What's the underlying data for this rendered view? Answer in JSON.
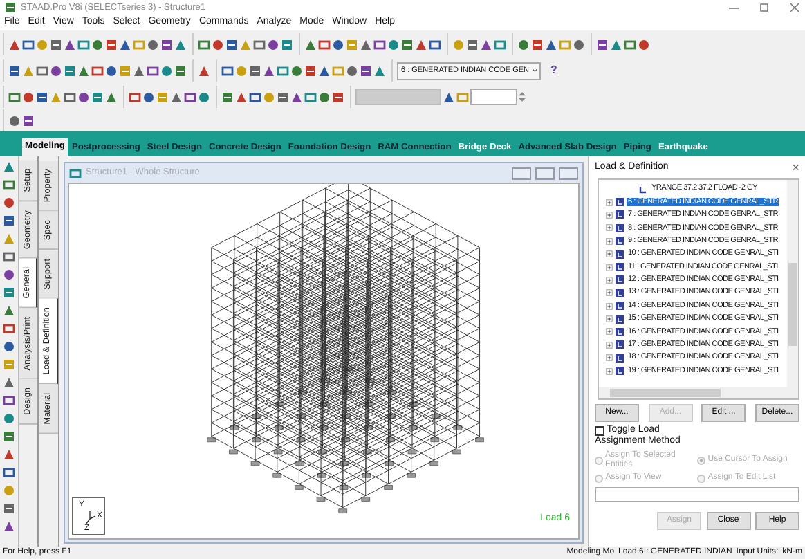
{
  "window": {
    "title": "STAAD.Pro V8i (SELECTseries 3) - Structure1"
  },
  "menu": [
    "File",
    "Edit",
    "View",
    "Tools",
    "Select",
    "Geometry",
    "Commands",
    "Analyze",
    "Mode",
    "Window",
    "Help"
  ],
  "toolbar": {
    "load_dropdown": "6 : GENERATED INDIAN CODE GEN",
    "help_glyph": "?"
  },
  "module_tabs": [
    {
      "label": "Modeling",
      "selected": true,
      "kind": "core"
    },
    {
      "label": "Postprocessing",
      "selected": false,
      "kind": "core"
    },
    {
      "label": "Steel Design",
      "selected": false,
      "kind": "core"
    },
    {
      "label": "Concrete Design",
      "selected": false,
      "kind": "core"
    },
    {
      "label": "Foundation Design",
      "selected": false,
      "kind": "core"
    },
    {
      "label": "RAM Connection",
      "selected": false,
      "kind": "core"
    },
    {
      "label": "Bridge Deck",
      "selected": false,
      "kind": "addon"
    },
    {
      "label": "Advanced Slab Design",
      "selected": false,
      "kind": "core"
    },
    {
      "label": "Piping",
      "selected": false,
      "kind": "core"
    },
    {
      "label": "Earthquake",
      "selected": false,
      "kind": "addon"
    }
  ],
  "page_tabs": [
    {
      "label": "Setup",
      "selected": false
    },
    {
      "label": "Geometry",
      "selected": false
    },
    {
      "label": "General",
      "selected": true
    },
    {
      "label": "Analysis/Print",
      "selected": false
    },
    {
      "label": "Design",
      "selected": false
    }
  ],
  "sub_tabs": [
    {
      "label": "Property",
      "selected": false
    },
    {
      "label": "Spec",
      "selected": false
    },
    {
      "label": "Support",
      "selected": false
    },
    {
      "label": "Load & Definition",
      "selected": true
    },
    {
      "label": "Material",
      "selected": false
    }
  ],
  "structure_window": {
    "title": "Structure1 - Whole Structure",
    "load_label": "Load 6",
    "axes": [
      "Y",
      "X",
      "Z"
    ]
  },
  "load_panel": {
    "title": "Load & Definition",
    "close": "×",
    "tree": [
      {
        "label": "YRANGE 37.2 37.2 FLOAD -2 GY",
        "kind": "load",
        "selected": false
      },
      {
        "label": "6 : GENERATED INDIAN CODE GENRAL_STR",
        "kind": "case",
        "selected": true
      },
      {
        "label": "7 : GENERATED INDIAN CODE GENRAL_STR",
        "kind": "case",
        "selected": false
      },
      {
        "label": "8 : GENERATED INDIAN CODE GENRAL_STR",
        "kind": "case",
        "selected": false
      },
      {
        "label": "9 : GENERATED INDIAN CODE GENRAL_STR",
        "kind": "case",
        "selected": false
      },
      {
        "label": "10 : GENERATED INDIAN CODE GENRAL_STI",
        "kind": "case",
        "selected": false
      },
      {
        "label": "11 : GENERATED INDIAN CODE GENRAL_STI",
        "kind": "case",
        "selected": false
      },
      {
        "label": "12 : GENERATED INDIAN CODE GENRAL_STI",
        "kind": "case",
        "selected": false
      },
      {
        "label": "13 : GENERATED INDIAN CODE GENRAL_STI",
        "kind": "case",
        "selected": false
      },
      {
        "label": "14 : GENERATED INDIAN CODE GENRAL_STI",
        "kind": "case",
        "selected": false
      },
      {
        "label": "15 : GENERATED INDIAN CODE GENRAL_STI",
        "kind": "case",
        "selected": false
      },
      {
        "label": "16 : GENERATED INDIAN CODE GENRAL_STI",
        "kind": "case",
        "selected": false
      },
      {
        "label": "17 : GENERATED INDIAN CODE GENRAL_STI",
        "kind": "case",
        "selected": false
      },
      {
        "label": "18 : GENERATED INDIAN CODE GENRAL_STI",
        "kind": "case",
        "selected": false
      },
      {
        "label": "19 : GENERATED INDIAN CODE GENRAL_STI",
        "kind": "case",
        "selected": false
      }
    ],
    "buttons": [
      {
        "label": "New...",
        "disabled": false
      },
      {
        "label": "Add...",
        "disabled": true
      },
      {
        "label": "Edit ...",
        "disabled": false
      },
      {
        "label": "Delete...",
        "disabled": false
      }
    ],
    "toggle_load": {
      "label": "Toggle Load",
      "checked": false
    },
    "assignment_title": "Assignment Method",
    "radios": [
      {
        "label": "Assign To Selected Entities",
        "selected": false,
        "disabled": true
      },
      {
        "label": "Use Cursor To Assign",
        "selected": true,
        "disabled": true
      },
      {
        "label": "Assign To View",
        "selected": false,
        "disabled": true
      },
      {
        "label": "Assign To Edit List",
        "selected": false,
        "disabled": true
      }
    ],
    "bottom_buttons": [
      {
        "label": "Assign",
        "disabled": true
      },
      {
        "label": "Close",
        "disabled": false
      },
      {
        "label": "Help",
        "disabled": false
      }
    ]
  },
  "status_bar": {
    "help": "For Help, press F1",
    "mode": "Modeling Mo",
    "load": "Load 6 : GENERATED INDIAN",
    "units": "Input Units:",
    "unit_value": "kN-m"
  }
}
